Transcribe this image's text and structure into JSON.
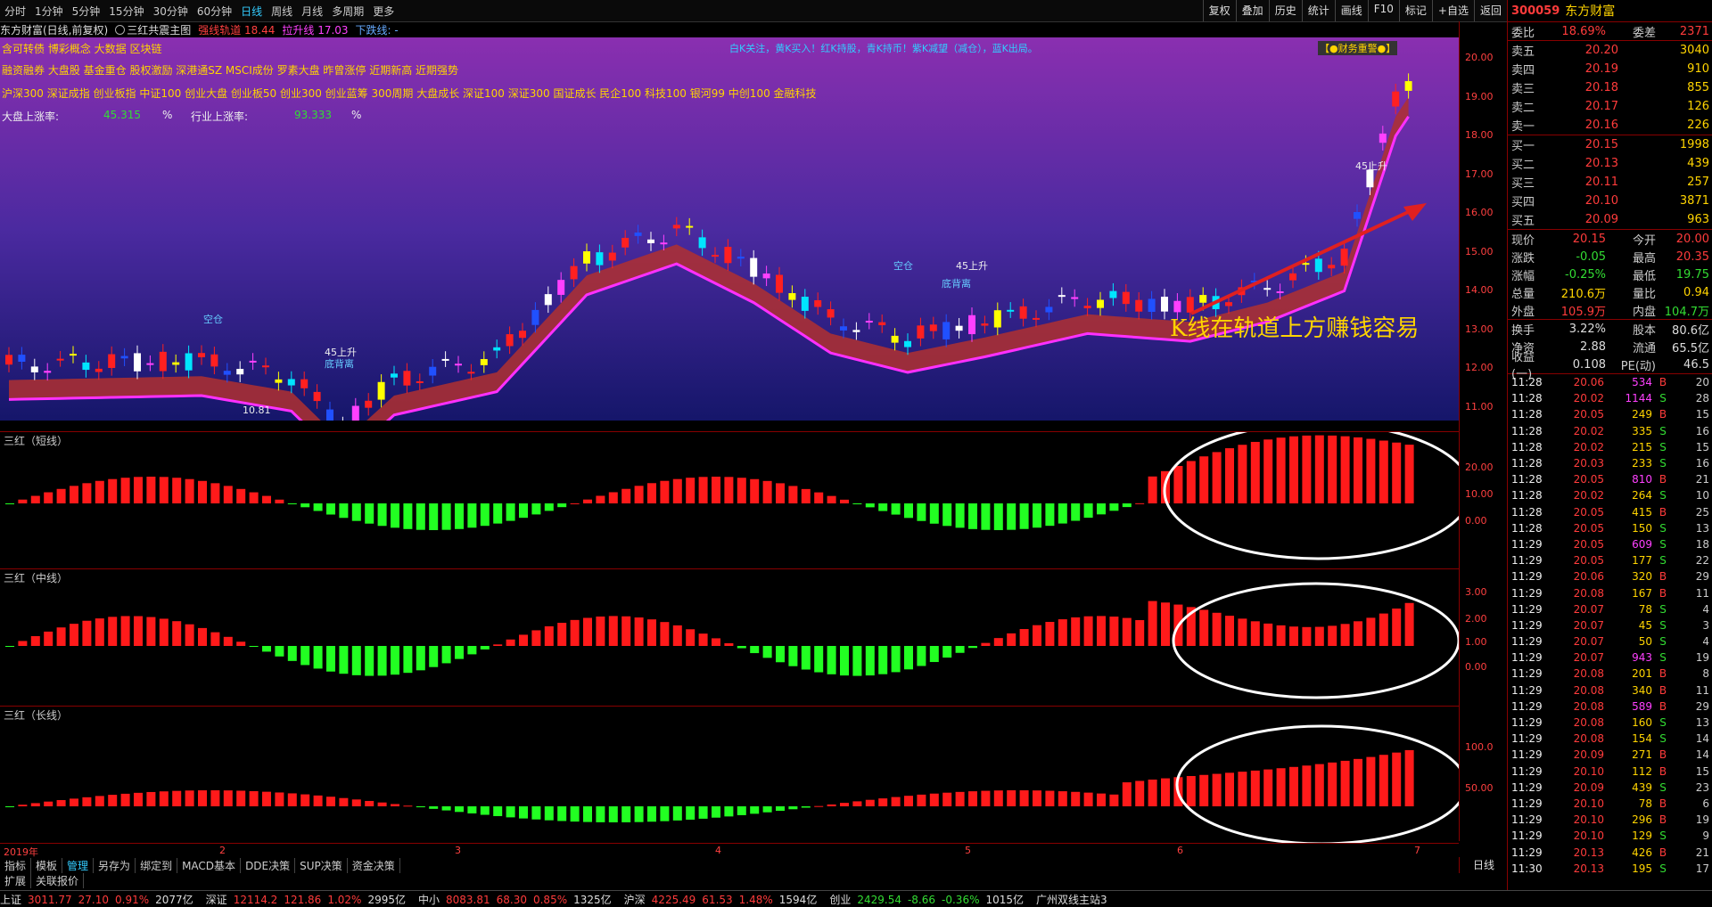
{
  "topbar": {
    "periods": [
      "分时",
      "1分钟",
      "5分钟",
      "15分钟",
      "30分钟",
      "60分钟",
      "日线",
      "周线",
      "月线",
      "多周期",
      "更多"
    ],
    "active_index": 6,
    "tools": [
      "复权",
      "叠加",
      "历史",
      "统计",
      "画线",
      "F10",
      "标记",
      "+自选",
      "返回"
    ]
  },
  "titlebar": {
    "stock": "东方财富(日线,前复权)",
    "formula": "三红共震主图",
    "rail": "强线轨道 18.44",
    "up": "拉升线 17.03",
    "down": "下跌线: -"
  },
  "tags": {
    "line1": "含可转债 博彩概念 大数据 区块链",
    "line2": "融资融券 大盘股 基金重仓 股权激励 深港通SZ MSCI成份 罗素大盘 昨曾涨停 近期新高 近期强势",
    "line3": "沪深300 深证成指 创业板指 中证100 创业大盘 创业板50 创业300 创业蓝筹 300周期 大盘成长 深证100 深证300 国证成长 民企100 科技100 银河99 中创100 金融科技",
    "market_up_label": "大盘上涨率:",
    "market_up_value": "45.315",
    "industry_up_label": "行业上涨率:",
    "industry_up_value": "93.333",
    "pct": "%",
    "legend": "白K关注，黄K买入！红K持股，青K持币！紫K减望（减仓），蓝K出局。",
    "finance_alert": "【●财务重警●】",
    "annotation": "K线在轨道上方赚钱容易",
    "low_label": "10.81",
    "signal_up": "45上升",
    "signal_bottom": "底背离",
    "signal_empty": "空仓"
  },
  "main_axis": [
    "20.00",
    "19.00",
    "18.00",
    "17.00",
    "16.00",
    "15.00",
    "14.00",
    "13.00",
    "12.00",
    "11.00"
  ],
  "date_axis": [
    "2019年",
    "2",
    "3",
    "4",
    "5",
    "6",
    "7"
  ],
  "indicators": [
    {
      "title": "三红（短线）",
      "axis": [
        "20.00",
        "10.00",
        "0.00"
      ]
    },
    {
      "title": "三红（中线）",
      "axis": [
        "3.00",
        "2.00",
        "1.00",
        "0.00"
      ]
    },
    {
      "title": "三红（长线）",
      "axis": [
        "100.0",
        "50.00"
      ]
    }
  ],
  "bottom_tabs": [
    "指标",
    "模板",
    "管理",
    "另存为",
    "绑定到",
    "MACD基本",
    "DDE决策",
    "SUP决策",
    "资金决策"
  ],
  "active_bottom": 2,
  "period_label": "日线",
  "sub_tabs": [
    "扩展",
    "关联报价"
  ],
  "side": {
    "code": "300059",
    "name": "东方财富",
    "ratio_label": "委比",
    "ratio_value": "18.69%",
    "diff_label": "委差",
    "diff_value": "2371",
    "asks": [
      {
        "k": "卖五",
        "p": "20.20",
        "q": "3040"
      },
      {
        "k": "卖四",
        "p": "20.19",
        "q": "910"
      },
      {
        "k": "卖三",
        "p": "20.18",
        "q": "855"
      },
      {
        "k": "卖二",
        "p": "20.17",
        "q": "126"
      },
      {
        "k": "卖一",
        "p": "20.16",
        "q": "226"
      }
    ],
    "bids": [
      {
        "k": "买一",
        "p": "20.15",
        "q": "1998"
      },
      {
        "k": "买二",
        "p": "20.13",
        "q": "439"
      },
      {
        "k": "买三",
        "p": "20.11",
        "q": "257"
      },
      {
        "k": "买四",
        "p": "20.10",
        "q": "3871"
      },
      {
        "k": "买五",
        "p": "20.09",
        "q": "963"
      }
    ],
    "quote": [
      {
        "k": "现价",
        "v": "20.15",
        "k2": "今开",
        "v2": "20.00",
        "c1": "red",
        "c2": "red"
      },
      {
        "k": "涨跌",
        "v": "-0.05",
        "k2": "最高",
        "v2": "20.35",
        "c1": "green",
        "c2": "red"
      },
      {
        "k": "涨幅",
        "v": "-0.25%",
        "k2": "最低",
        "v2": "19.75",
        "c1": "green",
        "c2": "green"
      },
      {
        "k": "总量",
        "v": "210.6万",
        "k2": "量比",
        "v2": "0.94",
        "c1": "yellow",
        "c2": "yellow"
      },
      {
        "k": "外盘",
        "v": "105.9万",
        "k2": "内盘",
        "v2": "104.7万",
        "c1": "red",
        "c2": "green"
      }
    ],
    "fund": [
      {
        "k": "换手",
        "v": "3.22%",
        "k2": "股本",
        "v2": "80.6亿"
      },
      {
        "k": "净资",
        "v": "2.88",
        "k2": "流通",
        "v2": "65.5亿"
      },
      {
        "k": "收益(一)",
        "v": "0.108",
        "k2": "PE(动)",
        "v2": "46.5"
      }
    ],
    "ticks": [
      {
        "t": "11:28",
        "p": "20.06",
        "v": "534",
        "d": "B",
        "n": "20"
      },
      {
        "t": "11:28",
        "p": "20.02",
        "v": "1144",
        "d": "S",
        "n": "28"
      },
      {
        "t": "11:28",
        "p": "20.05",
        "v": "249",
        "d": "B",
        "n": "15"
      },
      {
        "t": "11:28",
        "p": "20.02",
        "v": "335",
        "d": "S",
        "n": "16"
      },
      {
        "t": "11:28",
        "p": "20.02",
        "v": "215",
        "d": "S",
        "n": "15"
      },
      {
        "t": "11:28",
        "p": "20.03",
        "v": "233",
        "d": "S",
        "n": "16"
      },
      {
        "t": "11:28",
        "p": "20.05",
        "v": "810",
        "d": "B",
        "n": "21"
      },
      {
        "t": "11:28",
        "p": "20.02",
        "v": "264",
        "d": "S",
        "n": "10"
      },
      {
        "t": "11:28",
        "p": "20.05",
        "v": "415",
        "d": "B",
        "n": "25"
      },
      {
        "t": "11:28",
        "p": "20.05",
        "v": "150",
        "d": "S",
        "n": "13"
      },
      {
        "t": "11:29",
        "p": "20.05",
        "v": "609",
        "d": "S",
        "n": "18"
      },
      {
        "t": "11:29",
        "p": "20.05",
        "v": "177",
        "d": "S",
        "n": "22"
      },
      {
        "t": "11:29",
        "p": "20.06",
        "v": "320",
        "d": "B",
        "n": "29"
      },
      {
        "t": "11:29",
        "p": "20.08",
        "v": "167",
        "d": "B",
        "n": "11"
      },
      {
        "t": "11:29",
        "p": "20.07",
        "v": "78",
        "d": "S",
        "n": "4"
      },
      {
        "t": "11:29",
        "p": "20.07",
        "v": "45",
        "d": "S",
        "n": "3"
      },
      {
        "t": "11:29",
        "p": "20.07",
        "v": "50",
        "d": "S",
        "n": "4"
      },
      {
        "t": "11:29",
        "p": "20.07",
        "v": "943",
        "d": "S",
        "n": "19"
      },
      {
        "t": "11:29",
        "p": "20.08",
        "v": "201",
        "d": "B",
        "n": "8"
      },
      {
        "t": "11:29",
        "p": "20.08",
        "v": "340",
        "d": "B",
        "n": "11"
      },
      {
        "t": "11:29",
        "p": "20.08",
        "v": "589",
        "d": "B",
        "n": "29"
      },
      {
        "t": "11:29",
        "p": "20.08",
        "v": "160",
        "d": "S",
        "n": "13"
      },
      {
        "t": "11:29",
        "p": "20.08",
        "v": "154",
        "d": "S",
        "n": "14"
      },
      {
        "t": "11:29",
        "p": "20.09",
        "v": "271",
        "d": "B",
        "n": "14"
      },
      {
        "t": "11:29",
        "p": "20.10",
        "v": "112",
        "d": "B",
        "n": "15"
      },
      {
        "t": "11:29",
        "p": "20.09",
        "v": "439",
        "d": "S",
        "n": "23"
      },
      {
        "t": "11:29",
        "p": "20.10",
        "v": "78",
        "d": "B",
        "n": "6"
      },
      {
        "t": "11:29",
        "p": "20.10",
        "v": "296",
        "d": "B",
        "n": "19"
      },
      {
        "t": "11:29",
        "p": "20.10",
        "v": "129",
        "d": "S",
        "n": "9"
      },
      {
        "t": "11:29",
        "p": "20.13",
        "v": "426",
        "d": "B",
        "n": "21"
      },
      {
        "t": "11:30",
        "p": "20.13",
        "v": "195",
        "d": "S",
        "n": "17"
      }
    ]
  },
  "status_bar": [
    {
      "name": "上证",
      "price": "3011.77",
      "chg": "27.10",
      "pct": "0.91%",
      "amt": "2077亿",
      "cls": "red"
    },
    {
      "name": "深证",
      "price": "12114.2",
      "chg": "121.86",
      "pct": "1.02%",
      "amt": "2995亿",
      "cls": "red"
    },
    {
      "name": "中小",
      "price": "8083.81",
      "chg": "68.30",
      "pct": "0.85%",
      "amt": "1325亿",
      "cls": "red"
    },
    {
      "name": "沪深",
      "price": "4225.49",
      "chg": "61.53",
      "pct": "1.48%",
      "amt": "1594亿",
      "cls": "red"
    },
    {
      "name": "创业",
      "price": "2429.54",
      "chg": "-8.66",
      "pct": "-0.36%",
      "amt": "1015亿",
      "cls": "green"
    }
  ],
  "server": "广州双线主站3"
}
